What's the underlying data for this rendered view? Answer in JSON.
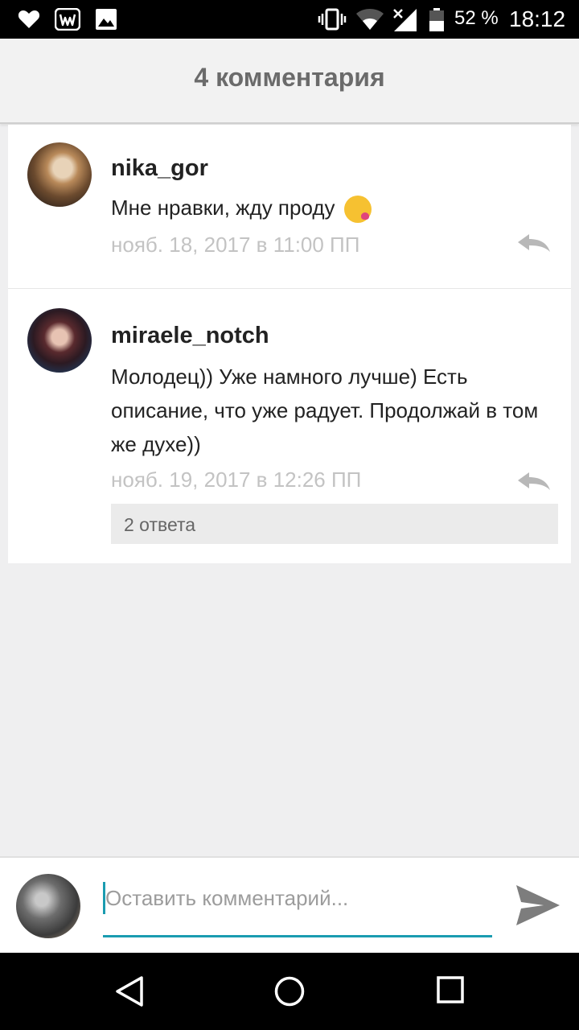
{
  "status_bar": {
    "battery_percent": "52 %",
    "time": "18:12",
    "icons": [
      "heart-icon",
      "wattpad-w-icon",
      "image-icon",
      "vibrate-icon",
      "wifi-icon",
      "signal-icon",
      "battery-icon"
    ]
  },
  "header": {
    "title": "4 комментария"
  },
  "comments": [
    {
      "author": "nika_gor",
      "text": "Мне нравки, жду проду",
      "timestamp": "нояб. 18, 2017 в 11:00 ПП",
      "emoji": "kissing-face-emoji"
    },
    {
      "author": "miraele_notch",
      "text": "Молодец)) Уже намного лучше) Есть описание, что уже радует. Продолжай в том же духе))",
      "timestamp": "нояб. 19, 2017 в 12:26 ПП",
      "replies_label": "2 ответа"
    }
  ],
  "input": {
    "placeholder": "Оставить комментарий...",
    "value": ""
  },
  "colors": {
    "accent": "#1a9cb0",
    "timestamp": "#c3c3c3",
    "header_text": "#6b6b6b"
  }
}
